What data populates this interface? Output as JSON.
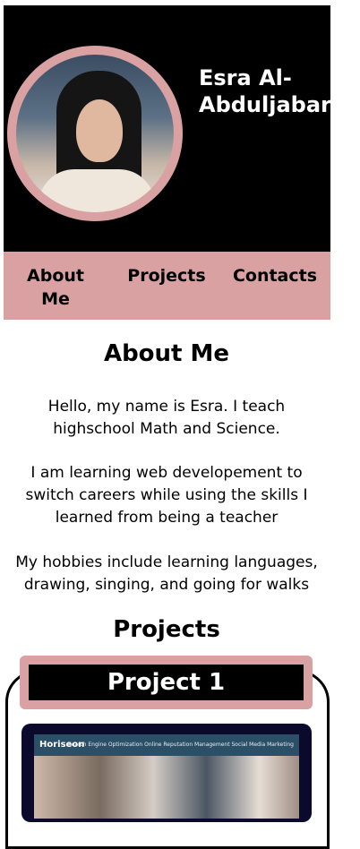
{
  "header": {
    "name": "Esra Al-Abduljabar"
  },
  "nav": {
    "items": [
      "About Me",
      "Projects",
      "Contacts"
    ]
  },
  "about": {
    "title": "About Me",
    "paragraphs": [
      "Hello, my name is Esra. I teach highschool Math and Science.",
      "I am learning web developement to switch careers while using the skills I learned from being a teacher",
      "My hobbies include learning languages, drawing, singing, and going for walks"
    ]
  },
  "projects": {
    "title": "Projects",
    "items": [
      {
        "title": "Project 1",
        "screenshot": {
          "brand": "Horiseon",
          "links": "Search Engine Optimization   Online Reputation Management   Social Media Marketing"
        }
      }
    ]
  },
  "colors": {
    "accent": "#d9a1a1",
    "header_bg": "#000000"
  }
}
